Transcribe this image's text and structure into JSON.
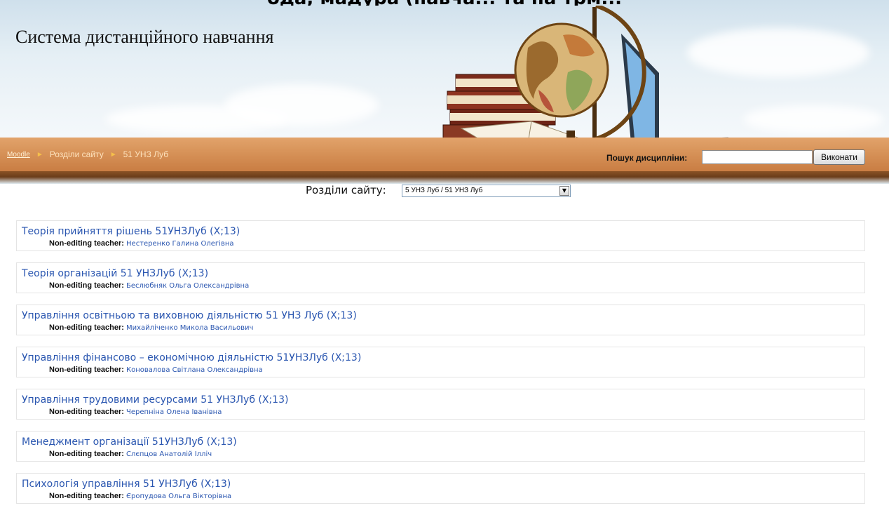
{
  "header": {
    "slice_text": "ода, мадура (навча... та на трм...",
    "site_title": "Система дистанційного навчання",
    "breadcrumb": [
      {
        "label": "Moodle",
        "link": true
      },
      {
        "label": "Розділи сайту",
        "link": false
      },
      {
        "label": "51 УНЗ Луб",
        "link": false
      }
    ],
    "breadcrumb_separator": "►",
    "search": {
      "label": "Пошук дисципліни:",
      "value": "",
      "button_label": "Виконати"
    }
  },
  "section_selector": {
    "label": "Розділи сайту:",
    "selected": "5 УНЗ Луб / 51 УНЗ Луб",
    "arrow_glyph": "▼"
  },
  "courses": [
    {
      "title": "Теорія прийняття рішень 51УНЗЛуб (Х;13)",
      "role": "Non-editing teacher:",
      "teacher": "Нестеренко Галина Олегівна"
    },
    {
      "title": "Теорія організацій 51 УНЗЛуб (Х;13)",
      "role": "Non-editing teacher:",
      "teacher": "Беслюбняк Ольга Олександрівна"
    },
    {
      "title": "Управління освітньою та виховною діяльністю 51 УНЗ Луб (Х;13)",
      "role": "Non-editing teacher:",
      "teacher": "Михайліченко Микола Васильович"
    },
    {
      "title": "Управління фінансово – економічною діяльністю 51УНЗЛуб (Х;13)",
      "role": "Non-editing teacher:",
      "teacher": "Коновалова Світлана Олександрівна"
    },
    {
      "title": "Управління трудовими ресурсами 51 УНЗЛуб (Х;13)",
      "role": "Non-editing teacher:",
      "teacher": "Черепніна Олена Іванівна"
    },
    {
      "title": "Менеджмент організації 51УНЗЛуб (Х;13)",
      "role": "Non-editing teacher:",
      "teacher": "Слєпцов Анатолій Ілліч"
    },
    {
      "title": "Психологія управління 51 УНЗЛуб (Х;13)",
      "role": "Non-editing teacher:",
      "teacher": "Єропудова Ольга Вікторівна"
    }
  ],
  "colors": {
    "link": "#2a56b0",
    "shelf": "#d8945a",
    "breadcrumb_separator": "#f6c04a"
  },
  "icons": [
    "globe-illustration",
    "books-illustration",
    "laptop-illustration",
    "dropdown-arrow-icon",
    "breadcrumb-arrow-icon"
  ]
}
